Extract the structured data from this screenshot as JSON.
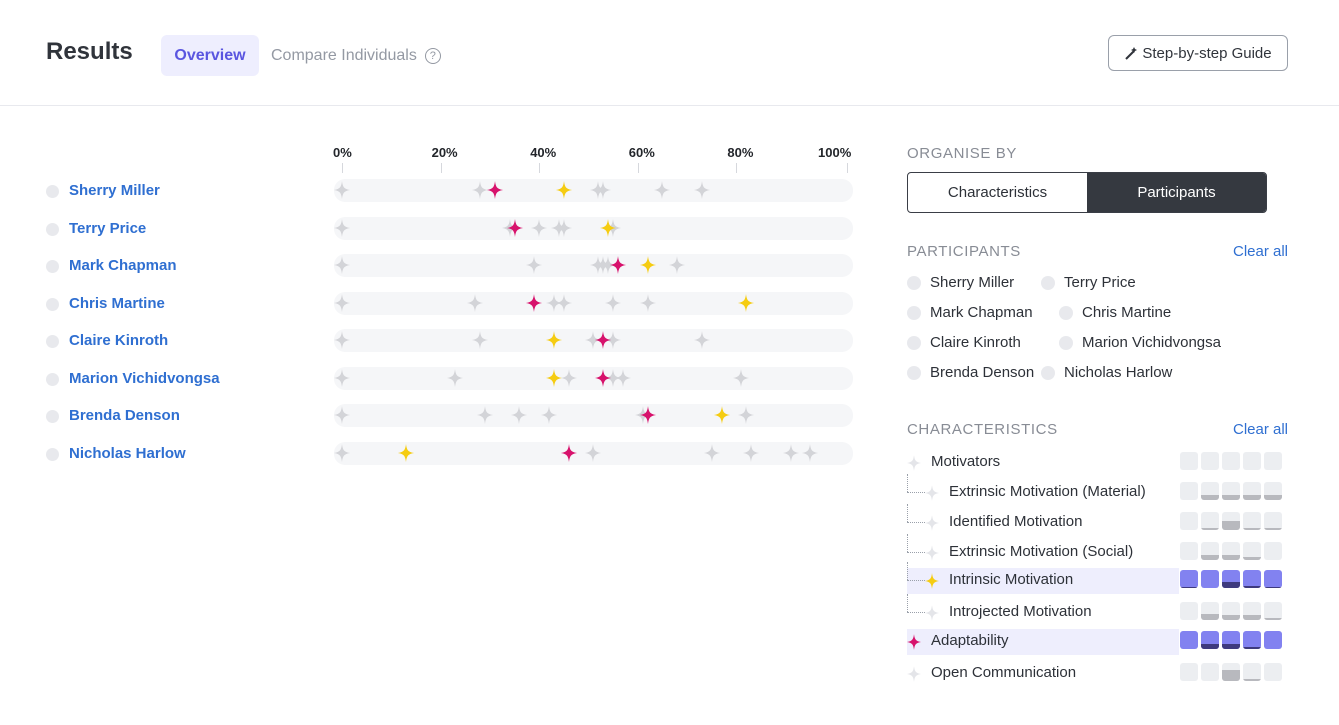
{
  "header": {
    "title": "Results",
    "tab_overview": "Overview",
    "tab_compare": "Compare Individuals",
    "help_icon": "?",
    "guide_button": "Step-by-step Guide",
    "guide_icon": "magic-wand-icon"
  },
  "axis": {
    "labels": [
      "0%",
      "20%",
      "40%",
      "60%",
      "80%",
      "100%"
    ],
    "values": [
      0,
      20,
      40,
      60,
      80,
      100
    ]
  },
  "chart_data": {
    "type": "scatter",
    "colors": {
      "neutral": "#d3d4d8",
      "intrinsic_motivation": "#f5cc12",
      "adaptability": "#d7126c"
    },
    "series_keys": [
      "intrinsic_motivation",
      "adaptability"
    ],
    "rows": [
      {
        "name": "Sherry Miller",
        "neutral": [
          0,
          28,
          52,
          53,
          65,
          73
        ],
        "intrinsic_motivation": 45,
        "adaptability": 31
      },
      {
        "name": "Terry Price",
        "neutral": [
          0,
          34,
          40,
          44,
          45,
          55
        ],
        "intrinsic_motivation": 54,
        "adaptability": 35
      },
      {
        "name": "Mark Chapman",
        "neutral": [
          0,
          39,
          52,
          53,
          54,
          68
        ],
        "intrinsic_motivation": 62,
        "adaptability": 56
      },
      {
        "name": "Chris Martine",
        "neutral": [
          0,
          27,
          43,
          45,
          55,
          62
        ],
        "intrinsic_motivation": 82,
        "adaptability": 39
      },
      {
        "name": "Claire Kinroth",
        "neutral": [
          0,
          28,
          51,
          55,
          73
        ],
        "intrinsic_motivation": 43,
        "adaptability": 53
      },
      {
        "name": "Marion Vichidvongsa",
        "neutral": [
          0,
          23,
          46,
          55,
          57,
          81
        ],
        "intrinsic_motivation": 43,
        "adaptability": 53
      },
      {
        "name": "Brenda Denson",
        "neutral": [
          0,
          29,
          36,
          42,
          61,
          82
        ],
        "intrinsic_motivation": 77,
        "adaptability": 62
      },
      {
        "name": "Nicholas Harlow",
        "neutral": [
          0,
          51,
          75,
          83,
          91,
          95
        ],
        "intrinsic_motivation": 13,
        "adaptability": 46
      }
    ]
  },
  "panel": {
    "organise_title": "ORGANISE BY",
    "seg_characteristics": "Characteristics",
    "seg_participants": "Participants",
    "participants_title": "PARTICIPANTS",
    "characteristics_title": "CHARACTERISTICS",
    "clear_all": "Clear all",
    "participants": [
      "Sherry Miller",
      "Terry Price",
      "Mark Chapman",
      "Chris Martine",
      "Claire Kinroth",
      "Marion Vichidvongsa",
      "Brenda Denson",
      "Nicholas Harlow"
    ],
    "characteristics": [
      {
        "label": "Motivators",
        "icon": "star-icon",
        "color": "#e4e5e9",
        "child": false,
        "highlight": false,
        "blue": false,
        "levels": [
          0,
          0,
          0,
          0,
          0
        ]
      },
      {
        "label": "Extrinsic Motivation (Material)",
        "icon": "star-icon",
        "color": "#e4e5e9",
        "child": true,
        "highlight": false,
        "blue": false,
        "levels": [
          0,
          0.25,
          0.25,
          0.25,
          0.25
        ]
      },
      {
        "label": "Identified Motivation",
        "icon": "star-icon",
        "color": "#e4e5e9",
        "child": true,
        "highlight": false,
        "blue": false,
        "levels": [
          0,
          0.1,
          0.5,
          0.1,
          0.1
        ]
      },
      {
        "label": "Extrinsic Motivation (Social)",
        "icon": "star-icon",
        "color": "#e4e5e9",
        "child": true,
        "highlight": false,
        "blue": false,
        "levels": [
          0,
          0.25,
          0.25,
          0.15,
          0
        ]
      },
      {
        "label": "Intrinsic Motivation",
        "icon": "star-icon",
        "color": "#f5cc12",
        "child": true,
        "highlight": true,
        "blue": true,
        "levels": [
          0.05,
          0,
          0.35,
          0.1,
          0.05
        ]
      },
      {
        "label": "Introjected Motivation",
        "icon": "star-icon",
        "color": "#e4e5e9",
        "child": true,
        "highlight": false,
        "blue": false,
        "levels": [
          0,
          0.35,
          0.25,
          0.25,
          0.1
        ]
      },
      {
        "label": "Adaptability",
        "icon": "star-icon",
        "color": "#d7126c",
        "child": false,
        "highlight": true,
        "blue": true,
        "levels": [
          0,
          0.25,
          0.25,
          0.1,
          0
        ]
      },
      {
        "label": "Open Communication",
        "icon": "star-icon",
        "color": "#e4e5e9",
        "child": false,
        "highlight": false,
        "blue": false,
        "levels": [
          0,
          0,
          0.6,
          0.1,
          0
        ]
      }
    ]
  }
}
